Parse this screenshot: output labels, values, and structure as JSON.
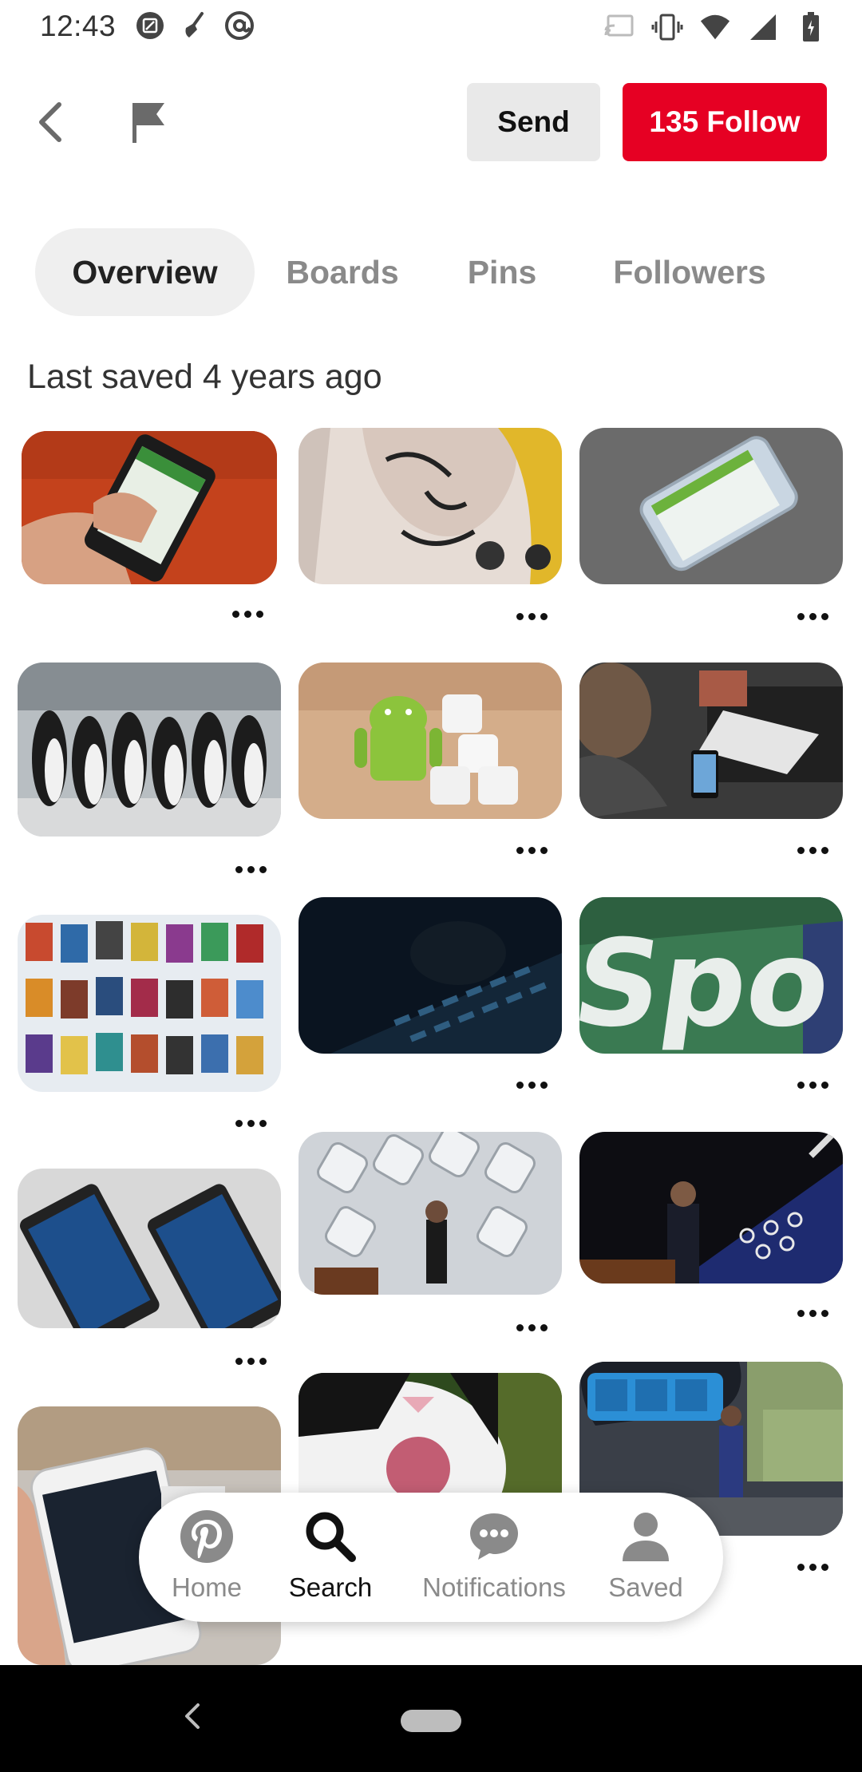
{
  "status_bar": {
    "time": "12:43",
    "left_icons": [
      "screenshot-icon",
      "broom-icon",
      "at-sign-icon"
    ],
    "right_icons": [
      "cast-icon",
      "vibrate-icon",
      "wifi-icon",
      "signal-icon",
      "battery-icon"
    ]
  },
  "header": {
    "back_icon": "chevron-left-icon",
    "report_icon": "flag-icon",
    "send_label": "Send",
    "follow_label": "135 Follow",
    "follow_color": "#e60023"
  },
  "tabs": [
    {
      "label": "Overview",
      "active": true
    },
    {
      "label": "Boards",
      "active": false
    },
    {
      "label": "Pins",
      "active": false
    },
    {
      "label": "Followers",
      "active": false
    }
  ],
  "section_title": "Last saved 4 years ago",
  "pins": [
    {
      "subject": "hand-holding-phone"
    },
    {
      "subject": "android-mural"
    },
    {
      "subject": "galaxy-phone"
    },
    {
      "subject": "penguins"
    },
    {
      "subject": "android-marshmallow"
    },
    {
      "subject": "person-using-phone"
    },
    {
      "subject": "movie-store"
    },
    {
      "subject": "backlit-keyboard"
    },
    {
      "subject": "spotify-logo"
    },
    {
      "subject": "lumia-phones"
    },
    {
      "subject": "keyboard-presenter"
    },
    {
      "subject": "surface-presenter"
    },
    {
      "subject": "galaxy-s6-edge"
    },
    {
      "subject": "yawning-cat"
    },
    {
      "subject": "microsoft-band-stage"
    }
  ],
  "bottom_nav": [
    {
      "label": "Home",
      "icon": "pinterest-icon",
      "active": false
    },
    {
      "label": "Search",
      "icon": "search-icon",
      "active": true
    },
    {
      "label": "Notifications",
      "icon": "chat-bubble-icon",
      "active": false
    },
    {
      "label": "Saved",
      "icon": "person-icon",
      "active": false
    }
  ],
  "system_nav": {
    "back_icon": "chevron-left-icon",
    "home_icon": "home-pill-icon"
  }
}
